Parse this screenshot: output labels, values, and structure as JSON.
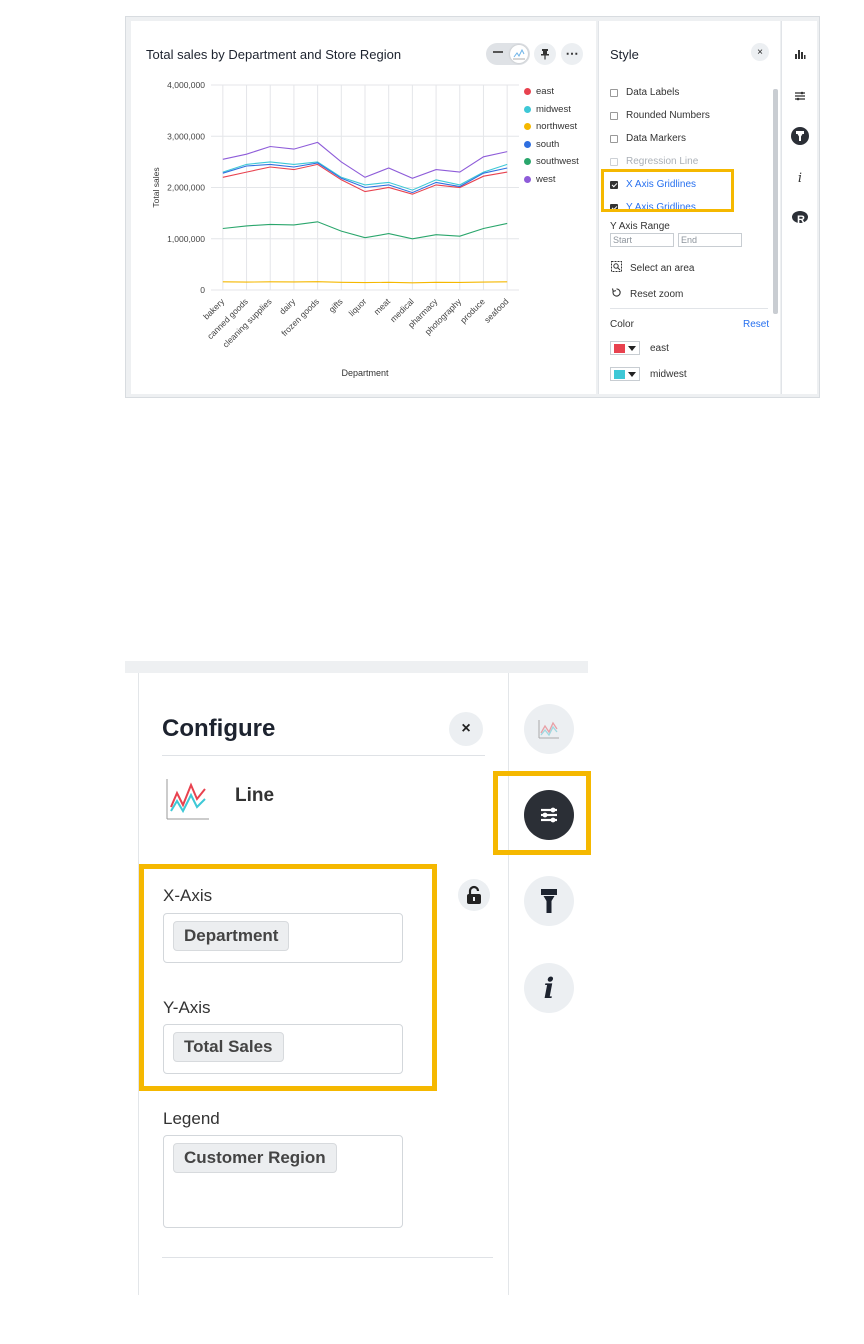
{
  "top": {
    "chart_title": "Total sales by Department and Store Region",
    "style_panel": {
      "title": "Style",
      "close_glyph": "×",
      "options": [
        {
          "label": "Data Labels",
          "checked": false,
          "state": "normal"
        },
        {
          "label": "Rounded Numbers",
          "checked": false,
          "state": "normal"
        },
        {
          "label": "Data Markers",
          "checked": false,
          "state": "normal"
        },
        {
          "label": "Regression Line",
          "checked": false,
          "state": "disabled"
        },
        {
          "label": "X Axis Gridlines",
          "checked": true,
          "state": "highlighted"
        },
        {
          "label": "Y Axis Gridlines",
          "checked": true,
          "state": "highlighted"
        }
      ],
      "y_axis_range_label": "Y Axis Range",
      "range_start_placeholder": "Start",
      "range_end_placeholder": "End",
      "select_area_label": "Select an area",
      "reset_zoom_label": "Reset zoom",
      "color_label": "Color",
      "reset_label": "Reset",
      "color_rows": [
        {
          "label": "east",
          "color": "#e8424f"
        },
        {
          "label": "midwest",
          "color": "#3ec8d6"
        }
      ]
    },
    "toolbar_icons": [
      "table-icon",
      "line-chart-icon",
      "pin-icon",
      "more-icon"
    ],
    "right_rail_icons": [
      "chart-type-icon",
      "configure-icon",
      "style-brush-icon",
      "info-icon",
      "r-analysis-icon"
    ],
    "more_glyph": "⋯",
    "info_glyph": "i"
  },
  "chart_data": {
    "type": "line",
    "title": "Total sales by Department and Store Region",
    "xlabel": "Department",
    "ylabel": "Total sales",
    "ylim": [
      0,
      4000000
    ],
    "yticks": [
      "0",
      "1,000,000",
      "2,000,000",
      "3,000,000",
      "4,000,000"
    ],
    "grid": {
      "x": true,
      "y": true
    },
    "legend_position": "right",
    "categories": [
      "bakery",
      "canned goods",
      "cleaning supplies",
      "dairy",
      "frozen goods",
      "gifts",
      "liquor",
      "meat",
      "medical",
      "pharmacy",
      "photography",
      "produce",
      "seafood"
    ],
    "series": [
      {
        "name": "east",
        "color": "#e8424f",
        "values": [
          2200000,
          2300000,
          2400000,
          2350000,
          2450000,
          2150000,
          1920000,
          2000000,
          1870000,
          2050000,
          2000000,
          2220000,
          2300000
        ]
      },
      {
        "name": "midwest",
        "color": "#3ec8d6",
        "values": [
          2300000,
          2450000,
          2500000,
          2450000,
          2500000,
          2200000,
          2050000,
          2100000,
          1950000,
          2150000,
          2050000,
          2300000,
          2450000
        ]
      },
      {
        "name": "northwest",
        "color": "#f5b800",
        "values": [
          160000,
          155000,
          160000,
          158000,
          162000,
          150000,
          145000,
          150000,
          140000,
          150000,
          148000,
          155000,
          160000
        ]
      },
      {
        "name": "south",
        "color": "#2f6fe0",
        "values": [
          2280000,
          2420000,
          2450000,
          2400000,
          2480000,
          2180000,
          2000000,
          2050000,
          1900000,
          2100000,
          2020000,
          2280000,
          2380000
        ]
      },
      {
        "name": "southwest",
        "color": "#2aa66c",
        "values": [
          1200000,
          1250000,
          1280000,
          1270000,
          1330000,
          1150000,
          1020000,
          1100000,
          1000000,
          1080000,
          1050000,
          1200000,
          1300000
        ]
      },
      {
        "name": "west",
        "color": "#8e5cd9",
        "values": [
          2550000,
          2650000,
          2800000,
          2750000,
          2880000,
          2500000,
          2200000,
          2380000,
          2180000,
          2350000,
          2300000,
          2600000,
          2700000
        ]
      }
    ]
  },
  "bottom": {
    "title": "Configure",
    "close_glyph": "×",
    "chart_type_label": "Line",
    "x_axis_label": "X-Axis",
    "x_axis_value": "Department",
    "y_axis_label": "Y-Axis",
    "y_axis_value": "Total Sales",
    "legend_label": "Legend",
    "legend_value": "Customer Region",
    "info_glyph": "i",
    "rail_icons": [
      "line-chart-icon",
      "configure-icon",
      "style-brush-icon",
      "info-icon"
    ]
  }
}
